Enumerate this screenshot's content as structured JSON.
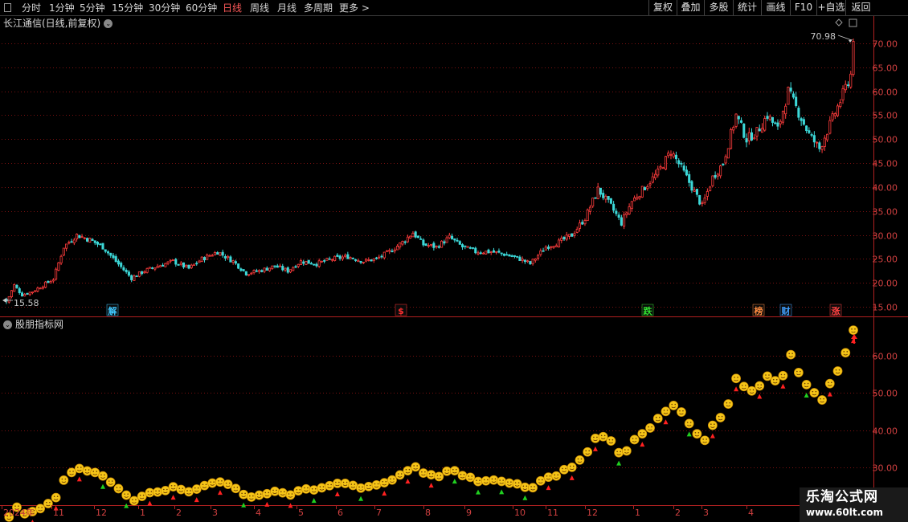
{
  "toolbar": {
    "periods": [
      "分时",
      "1分钟",
      "5分钟",
      "15分钟",
      "30分钟",
      "60分钟",
      "日线",
      "周线",
      "月线",
      "多周期",
      "更多"
    ],
    "active_period": "日线",
    "more_arrow": ">",
    "buttons": [
      "复权",
      "叠加",
      "多股",
      "统计",
      "画线",
      "F10",
      "+自选",
      "返回"
    ]
  },
  "main_chart": {
    "title": "长江通信(日线,前复权)",
    "high_label": "70.98",
    "low_label": "15.58",
    "events": [
      {
        "label": "解",
        "color": "#40c8ff"
      },
      {
        "label": "$",
        "color": "#ff3030"
      },
      {
        "label": "跌",
        "color": "#30e030"
      },
      {
        "label": "榜",
        "color": "#ff8c40"
      },
      {
        "label": "财",
        "color": "#40a0ff"
      },
      {
        "label": "涨",
        "color": "#ff4040"
      }
    ]
  },
  "indicator": {
    "title": "股朋指标网"
  },
  "chart_data": {
    "type": "candlestick",
    "y_ticks": [
      15,
      20,
      25,
      30,
      35,
      40,
      45,
      50,
      55,
      60,
      65,
      70
    ],
    "ylim": [
      13,
      73
    ],
    "indicator_y_ticks": [
      30,
      40,
      50,
      60
    ],
    "indicator_ylim": [
      20,
      70
    ],
    "x_labels": [
      "2024年",
      "11",
      "12",
      "1",
      "2",
      "3",
      "4",
      "5",
      "6",
      "7",
      "8",
      "9",
      "10",
      "11",
      "12",
      "1",
      "2",
      "3",
      "4"
    ],
    "keypoints": [
      [
        0,
        16.0
      ],
      [
        3,
        19.5
      ],
      [
        6,
        17.5
      ],
      [
        10,
        18.2
      ],
      [
        14,
        19.5
      ],
      [
        18,
        20.8
      ],
      [
        22,
        27.5
      ],
      [
        27,
        30.0
      ],
      [
        32,
        29.0
      ],
      [
        37,
        27.5
      ],
      [
        42,
        24.5
      ],
      [
        48,
        21.0
      ],
      [
        53,
        22.5
      ],
      [
        58,
        23.5
      ],
      [
        64,
        24.5
      ],
      [
        70,
        23.0
      ],
      [
        75,
        25.0
      ],
      [
        81,
        26.5
      ],
      [
        87,
        24.5
      ],
      [
        92,
        22.0
      ],
      [
        97,
        22.5
      ],
      [
        103,
        23.5
      ],
      [
        108,
        22.5
      ],
      [
        113,
        24.5
      ],
      [
        119,
        24.0
      ],
      [
        125,
        25.0
      ],
      [
        131,
        25.5
      ],
      [
        137,
        24.5
      ],
      [
        142,
        25.0
      ],
      [
        147,
        26.5
      ],
      [
        152,
        28.5
      ],
      [
        156,
        30.5
      ],
      [
        160,
        28.0
      ],
      [
        165,
        27.5
      ],
      [
        170,
        29.5
      ],
      [
        175,
        27.5
      ],
      [
        180,
        26.5
      ],
      [
        186,
        26.5
      ],
      [
        191,
        26.0
      ],
      [
        197,
        25.0
      ],
      [
        201,
        24.0
      ],
      [
        207,
        27.5
      ],
      [
        212,
        28.5
      ],
      [
        217,
        30.0
      ],
      [
        222,
        33.5
      ],
      [
        227,
        39.5
      ],
      [
        232,
        36.0
      ],
      [
        236,
        32.5
      ],
      [
        240,
        37.0
      ],
      [
        245,
        40.0
      ],
      [
        250,
        43.0
      ],
      [
        255,
        47.5
      ],
      [
        259,
        44.0
      ],
      [
        263,
        40.0
      ],
      [
        267,
        36.0
      ],
      [
        271,
        42.0
      ],
      [
        275,
        45.0
      ],
      [
        280,
        55.0
      ],
      [
        284,
        50.0
      ],
      [
        288,
        51.5
      ],
      [
        292,
        55.0
      ],
      [
        296,
        52.0
      ],
      [
        300,
        60.0
      ],
      [
        304,
        55.5
      ],
      [
        308,
        51.0
      ],
      [
        312,
        48.0
      ],
      [
        316,
        53.0
      ],
      [
        320,
        58.0
      ],
      [
        324,
        63.5
      ],
      [
        325,
        70.98
      ]
    ],
    "bar_count": 326,
    "high": 70.98,
    "low": 15.58
  }
}
